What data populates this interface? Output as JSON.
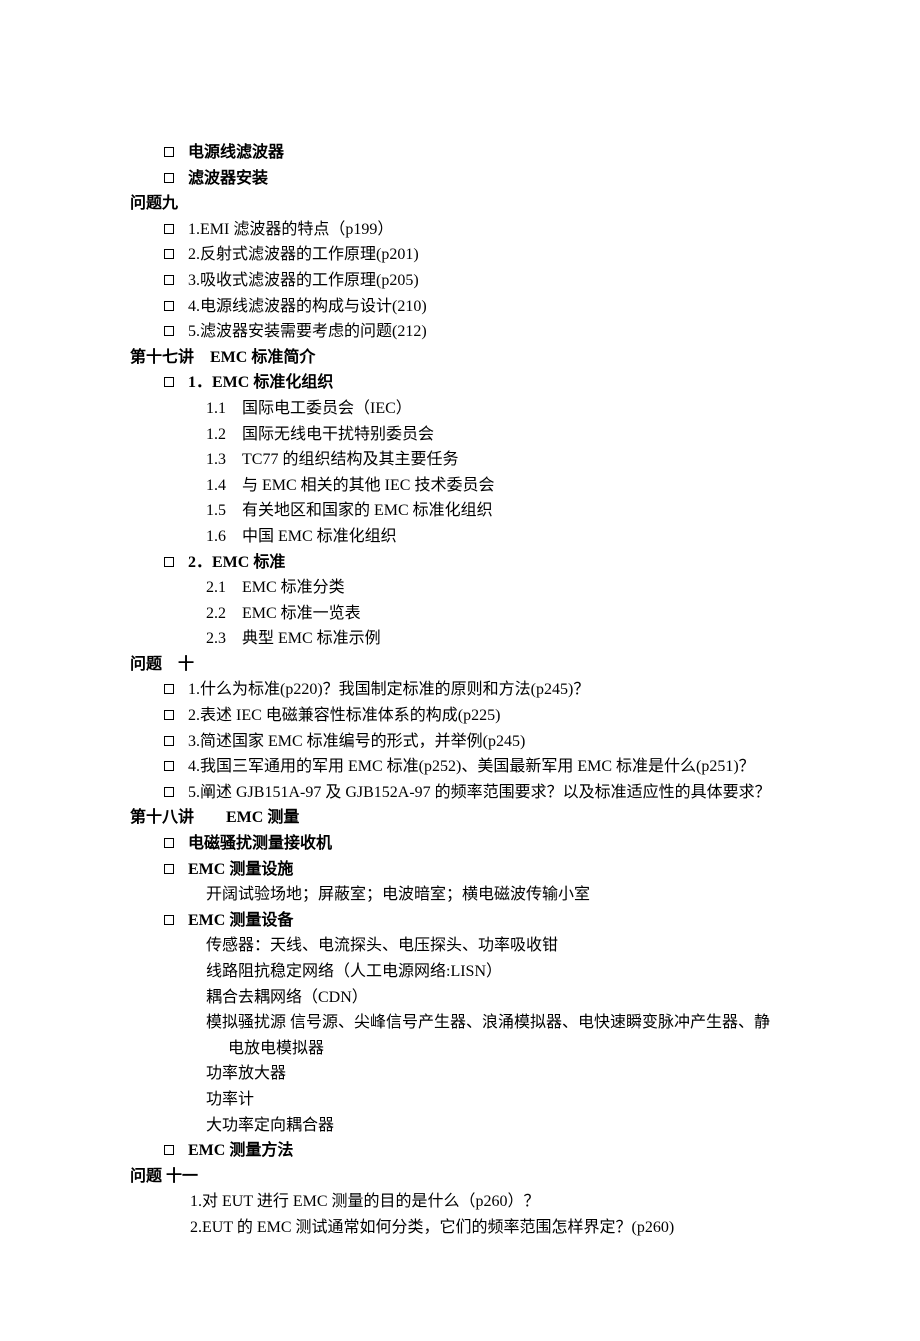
{
  "pre_items": [
    {
      "text": "电源线滤波器",
      "bold": true
    },
    {
      "text": "滤波器安装",
      "bold": true
    }
  ],
  "q9": {
    "title": "问题九",
    "items": [
      "1.EMI 滤波器的特点（p199）",
      "2.反射式滤波器的工作原理(p201)",
      "3.吸收式滤波器的工作原理(p205)",
      "4.电源线滤波器的构成与设计(210)",
      "5.滤波器安装需要考虑的问题(212)"
    ]
  },
  "lec17": {
    "title": "第十七讲 EMC 标准简介",
    "sec1": {
      "heading": "1．EMC 标准化组织",
      "items": [
        "1.1 国际电工委员会（IEC）",
        "1.2 国际无线电干扰特别委员会",
        "1.3 TC77 的组织结构及其主要任务",
        "1.4 与 EMC 相关的其他 IEC 技术委员会",
        "1.5 有关地区和国家的 EMC 标准化组织",
        "1.6 中国 EMC 标准化组织"
      ]
    },
    "sec2": {
      "heading": "2．EMC 标准",
      "items": [
        "2.1 EMC 标准分类",
        "2.2 EMC 标准一览表",
        "2.3 典型 EMC 标准示例"
      ]
    }
  },
  "q10": {
    "title": "问题 十",
    "items": [
      "1.什么为标准(p220)？我国制定标准的原则和方法(p245)？",
      "2.表述 IEC 电磁兼容性标准体系的构成(p225)",
      "3.简述国家 EMC 标准编号的形式，并举例(p245)",
      "4.我国三军通用的军用 EMC 标准(p252)、美国最新军用 EMC 标准是什么(p251)？",
      "5.阐述 GJB151A-97 及 GJB152A-97 的频率范围要求？以及标准适应性的具体要求？"
    ]
  },
  "lec18": {
    "title": "第十八讲  EMC 测量",
    "items": [
      {
        "text": "电磁骚扰测量接收机",
        "bold": true,
        "sub": []
      },
      {
        "text": "EMC 测量设施",
        "bold": true,
        "sub": [
          "开阔试验场地；屏蔽室；电波暗室；横电磁波传输小室"
        ]
      },
      {
        "text": "EMC 测量设备",
        "bold": true,
        "sub": [
          "传感器：天线、电流探头、电压探头、功率吸收钳",
          "线路阻抗稳定网络（人工电源网络:LISN）",
          "耦合去耦网络（CDN）",
          "模拟骚扰源 信号源、尖峰信号产生器、浪涌模拟器、电快速瞬变脉冲产生器、静",
          " 电放电模拟器",
          "功率放大器",
          "功率计",
          "大功率定向耦合器"
        ]
      },
      {
        "text": "EMC 测量方法",
        "bold": true,
        "sub": []
      }
    ]
  },
  "q11": {
    "title": "问题 十一",
    "items": [
      "1.对 EUT 进行 EMC 测量的目的是什么（p260）？",
      "2.EUT 的 EMC 测试通常如何分类，它们的频率范围怎样界定？(p260)"
    ]
  }
}
